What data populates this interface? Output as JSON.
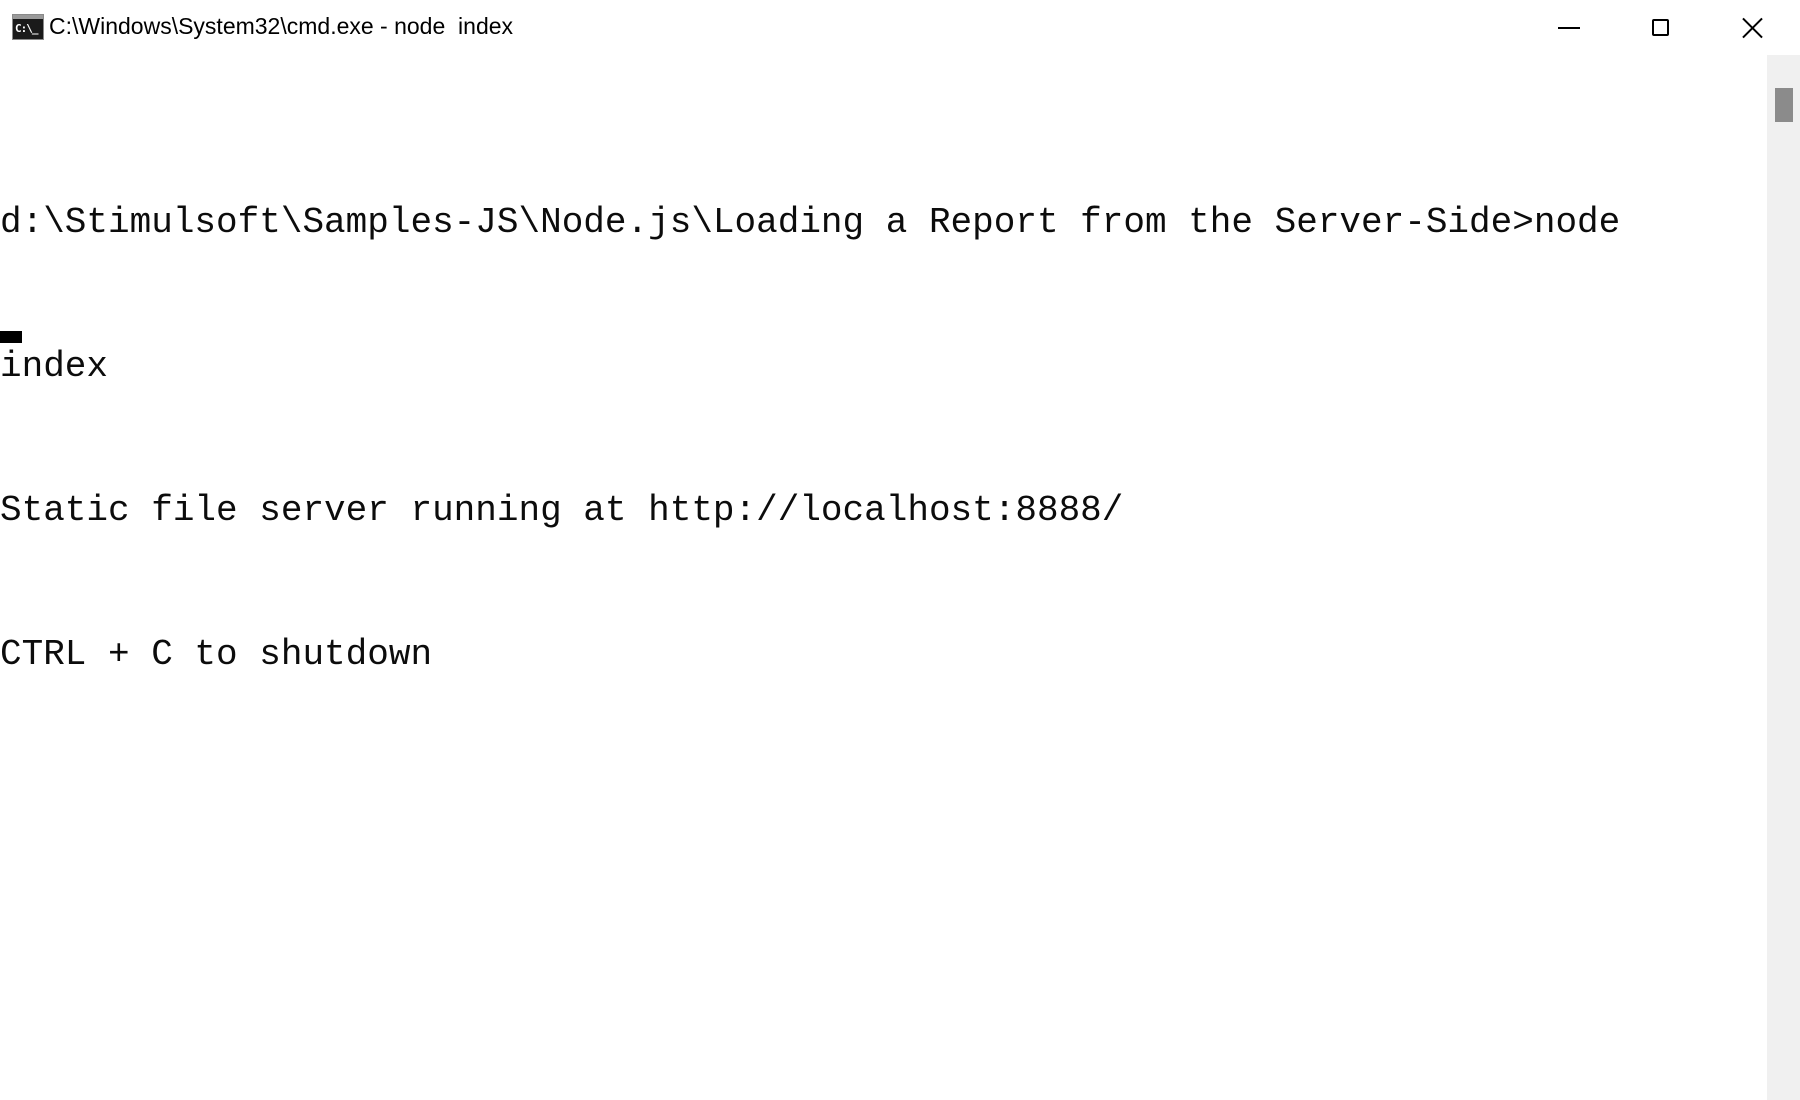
{
  "window": {
    "title": "C:\\Windows\\System32\\cmd.exe - node  index",
    "icon": "cmd-icon",
    "icon_glyph": "C:\\_",
    "controls": {
      "minimize": "minimize-icon",
      "maximize": "maximize-icon",
      "close": "close-icon"
    }
  },
  "console": {
    "lines": [
      "d:\\Stimulsoft\\Samples-JS\\Node.js\\Loading a Report from the Server-Side>node",
      "index",
      "Static file server running at http://localhost:8888/",
      "CTRL + C to shutdown"
    ],
    "background": "#ffffff",
    "foreground": "#0c0c0c"
  },
  "scrollbar": {
    "position": 0
  }
}
